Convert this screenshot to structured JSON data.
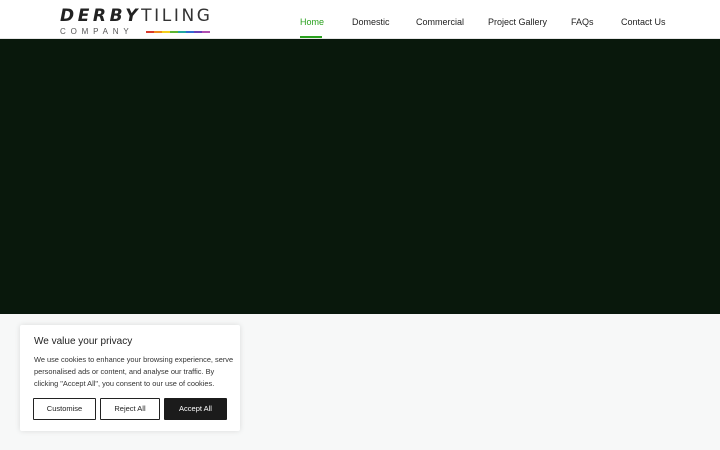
{
  "logo": {
    "word1": "DERBY",
    "word2": "TILING",
    "word3": "COMPANY",
    "stripe_colors": [
      "#d83a2c",
      "#f08a1c",
      "#f2cf1d",
      "#5cb532",
      "#21a6a0",
      "#2f6bd0",
      "#6a3fb8",
      "#b04fb0"
    ]
  },
  "nav": {
    "items": [
      {
        "label": "Home"
      },
      {
        "label": "Domestic"
      },
      {
        "label": "Commercial"
      },
      {
        "label": "Project Gallery"
      },
      {
        "label": "FAQs"
      },
      {
        "label": "Contact Us"
      }
    ],
    "active_index": 0,
    "active_color": "#2aa11e"
  },
  "hero": {
    "background": "#09180c"
  },
  "cookie": {
    "title": "We value your privacy",
    "text": "We use cookies to enhance your browsing experience, serve personalised ads or content, and analyse our traffic. By clicking \"Accept All\", you consent to our use of cookies.",
    "customise_label": "Customise",
    "reject_label": "Reject All",
    "accept_label": "Accept All"
  }
}
